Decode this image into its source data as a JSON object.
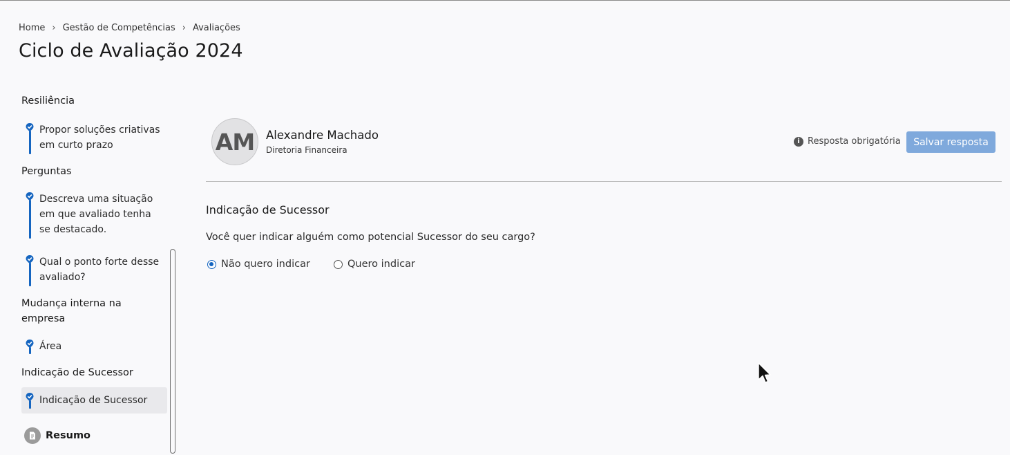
{
  "breadcrumb": {
    "items": [
      "Home",
      "Gestão de Competências",
      "Avaliações"
    ],
    "separator": "›"
  },
  "page": {
    "title": "Ciclo de Avaliação 2024"
  },
  "sidebar": {
    "partial_section": "Resiliência",
    "items": [
      {
        "label": "Propor soluções criativas em curto prazo"
      },
      {
        "section": "Perguntas"
      },
      {
        "label": "Descreva uma situação em que avaliado tenha se destacado."
      },
      {
        "label": "Qual o ponto forte desse avaliado?"
      },
      {
        "section": "Mudança interna na empresa"
      },
      {
        "label": "Área"
      },
      {
        "section": "Indicação de Sucessor"
      },
      {
        "label": "Indicação de Sucessor",
        "active": true
      }
    ],
    "resumo_label": "Resumo"
  },
  "person": {
    "initials": "AM",
    "name": "Alexandre Machado",
    "department": "Diretoria Financeira"
  },
  "header_actions": {
    "required_note": "Resposta obrigatória",
    "save_label": "Salvar resposta"
  },
  "form": {
    "section_heading": "Indicação de Sucessor",
    "question": "Você quer indicar alguém como potencial Sucessor do seu cargo?",
    "options": [
      {
        "label": "Não quero indicar",
        "selected": true
      },
      {
        "label": "Quero indicar",
        "selected": false
      }
    ]
  },
  "colors": {
    "accent": "#1565c0",
    "save_button": "#7fa9dc",
    "background": "#f9f9fb"
  }
}
